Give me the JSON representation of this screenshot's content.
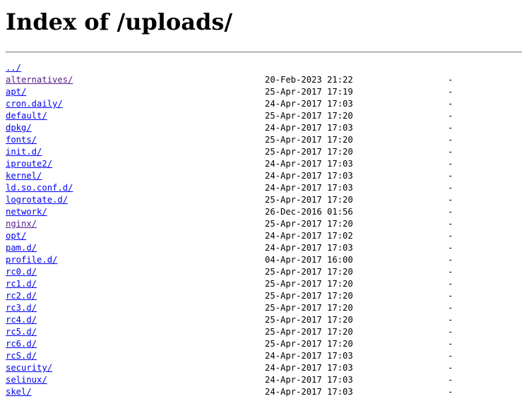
{
  "page": {
    "title": "Index of /uploads/"
  },
  "colors": {
    "link": "#0000ee",
    "visited_link": "#551a8b",
    "rule": "#888888"
  },
  "listing": [
    {
      "name": "../",
      "date": "",
      "size": "",
      "visited": false
    },
    {
      "name": "alternatives/",
      "date": "20-Feb-2023 21:22",
      "size": "-",
      "visited": true
    },
    {
      "name": "apt/",
      "date": "25-Apr-2017 17:19",
      "size": "-",
      "visited": false
    },
    {
      "name": "cron.daily/",
      "date": "24-Apr-2017 17:03",
      "size": "-",
      "visited": false
    },
    {
      "name": "default/",
      "date": "25-Apr-2017 17:20",
      "size": "-",
      "visited": false
    },
    {
      "name": "dpkg/",
      "date": "24-Apr-2017 17:03",
      "size": "-",
      "visited": false
    },
    {
      "name": "fonts/",
      "date": "25-Apr-2017 17:20",
      "size": "-",
      "visited": false
    },
    {
      "name": "init.d/",
      "date": "25-Apr-2017 17:20",
      "size": "-",
      "visited": false
    },
    {
      "name": "iproute2/",
      "date": "24-Apr-2017 17:03",
      "size": "-",
      "visited": false
    },
    {
      "name": "kernel/",
      "date": "24-Apr-2017 17:03",
      "size": "-",
      "visited": false
    },
    {
      "name": "ld.so.conf.d/",
      "date": "24-Apr-2017 17:03",
      "size": "-",
      "visited": false
    },
    {
      "name": "logrotate.d/",
      "date": "25-Apr-2017 17:20",
      "size": "-",
      "visited": false
    },
    {
      "name": "network/",
      "date": "26-Dec-2016 01:56",
      "size": "-",
      "visited": false
    },
    {
      "name": "nginx/",
      "date": "25-Apr-2017 17:20",
      "size": "-",
      "visited": true
    },
    {
      "name": "opt/",
      "date": "24-Apr-2017 17:02",
      "size": "-",
      "visited": false
    },
    {
      "name": "pam.d/",
      "date": "24-Apr-2017 17:03",
      "size": "-",
      "visited": false
    },
    {
      "name": "profile.d/",
      "date": "04-Apr-2017 16:00",
      "size": "-",
      "visited": false
    },
    {
      "name": "rc0.d/",
      "date": "25-Apr-2017 17:20",
      "size": "-",
      "visited": false
    },
    {
      "name": "rc1.d/",
      "date": "25-Apr-2017 17:20",
      "size": "-",
      "visited": false
    },
    {
      "name": "rc2.d/",
      "date": "25-Apr-2017 17:20",
      "size": "-",
      "visited": false
    },
    {
      "name": "rc3.d/",
      "date": "25-Apr-2017 17:20",
      "size": "-",
      "visited": false
    },
    {
      "name": "rc4.d/",
      "date": "25-Apr-2017 17:20",
      "size": "-",
      "visited": false
    },
    {
      "name": "rc5.d/",
      "date": "25-Apr-2017 17:20",
      "size": "-",
      "visited": false
    },
    {
      "name": "rc6.d/",
      "date": "25-Apr-2017 17:20",
      "size": "-",
      "visited": false
    },
    {
      "name": "rcS.d/",
      "date": "24-Apr-2017 17:03",
      "size": "-",
      "visited": false
    },
    {
      "name": "security/",
      "date": "24-Apr-2017 17:03",
      "size": "-",
      "visited": false
    },
    {
      "name": "selinux/",
      "date": "24-Apr-2017 17:03",
      "size": "-",
      "visited": false
    },
    {
      "name": "skel/",
      "date": "24-Apr-2017 17:03",
      "size": "-",
      "visited": false
    }
  ]
}
